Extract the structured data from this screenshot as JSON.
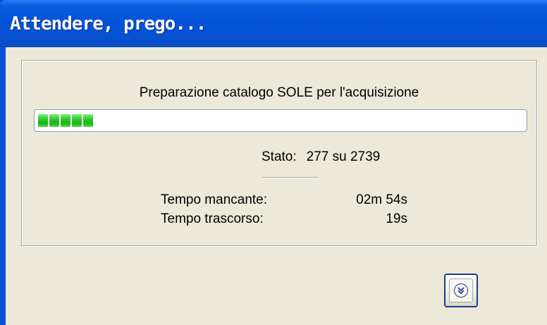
{
  "window": {
    "title": "Attendere, prego..."
  },
  "dialog": {
    "heading": "Preparazione catalogo SOLE per l'acquisizione",
    "progress": {
      "current": 277,
      "total": 2739,
      "percent": 10.1
    },
    "status": {
      "label": "Stato:",
      "value": "277 su 2739"
    },
    "time_remaining": {
      "label": "Tempo mancante:",
      "value": "02m 54s"
    },
    "time_elapsed": {
      "label": "Tempo trascorso:",
      "value": "19s"
    }
  },
  "buttons": {
    "details_icon": "chevron-double-down-icon"
  },
  "colors": {
    "titlebar": "#0553d8",
    "progress_fill": "#2ec72e",
    "face": "#ece9d8"
  }
}
